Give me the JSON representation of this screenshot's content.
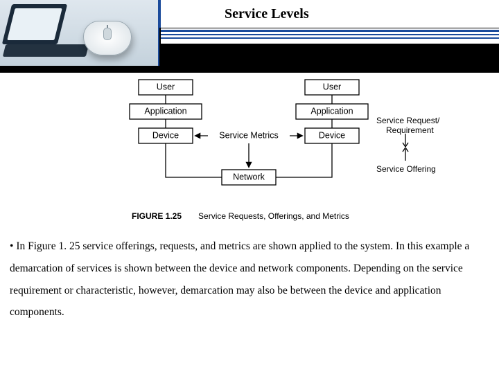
{
  "header": {
    "title": "Service Levels"
  },
  "diagram": {
    "left_stack": [
      "User",
      "Application",
      "Device"
    ],
    "right_stack": [
      "User",
      "Application",
      "Device"
    ],
    "center_label": "Service Metrics",
    "bottom_box": "Network",
    "right_upper_label": "Service Request/\nRequirement",
    "right_lower_label": "Service Offering"
  },
  "figure": {
    "label": "FIGURE 1.25",
    "caption": "Service Requests, Offerings, and Metrics"
  },
  "body": {
    "bullet": "•",
    "text": "In Figure 1. 25 service offerings, requests, and metrics are shown applied to the system. In this example a demarcation of services is shown between the device and network components. Depending on the service requirement or characteristic, however, demarcation may also be between the device and application components."
  }
}
